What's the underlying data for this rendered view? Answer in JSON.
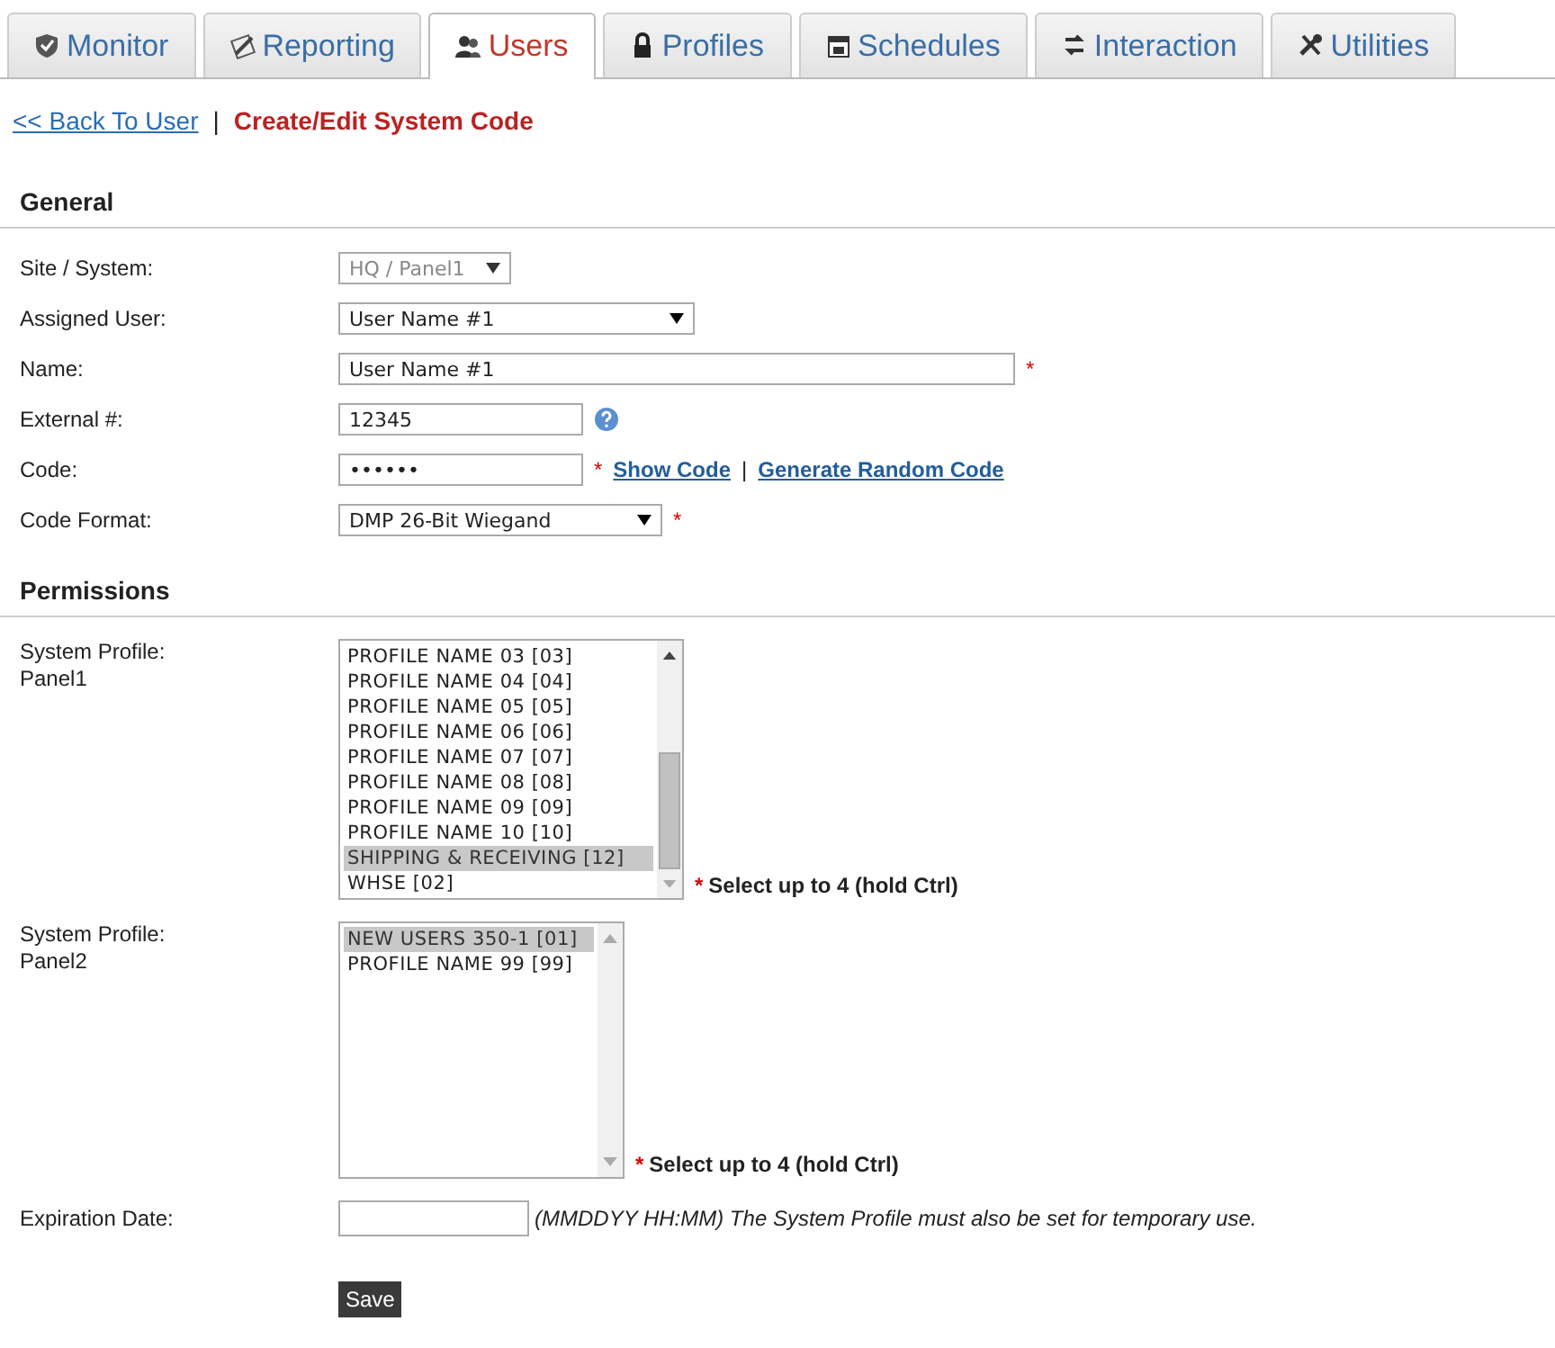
{
  "tabs": [
    {
      "label": "Monitor",
      "selected": false
    },
    {
      "label": "Reporting",
      "selected": false
    },
    {
      "label": "Users",
      "selected": true
    },
    {
      "label": "Profiles",
      "selected": false
    },
    {
      "label": "Schedules",
      "selected": false
    },
    {
      "label": "Interaction",
      "selected": false
    },
    {
      "label": "Utilities",
      "selected": false
    }
  ],
  "breadcrumb": {
    "back_link": "<< Back To User",
    "separator": "|",
    "title": "Create/Edit System Code"
  },
  "general": {
    "heading": "General",
    "fields": [
      {
        "kind": "select",
        "label": "Site / System:",
        "value": "HQ / Panel1",
        "disabled": true
      },
      {
        "kind": "select",
        "label": "Assigned User:",
        "value": "User Name #1",
        "disabled": false
      },
      {
        "kind": "text",
        "label": "Name:",
        "value": "User Name #1",
        "required_mark": "*"
      },
      {
        "kind": "text",
        "label": "External #:",
        "value": "12345",
        "help": true
      },
      {
        "kind": "password",
        "label": "Code:",
        "value": "••••••",
        "required_mark": "*",
        "links": [
          "Show Code",
          "Generate Random Code"
        ],
        "link_separator": "|"
      },
      {
        "kind": "select",
        "label": "Code Format:",
        "value": "DMP 26-Bit Wiegand",
        "disabled": false,
        "required_mark": "*"
      }
    ]
  },
  "permissions": {
    "heading": "Permissions",
    "profiles": [
      {
        "label": [
          "System Profile:",
          "Panel1"
        ],
        "items": [
          {
            "text": "PROFILE NAME 03 [03]",
            "selected": false
          },
          {
            "text": "PROFILE NAME 04 [04]",
            "selected": false
          },
          {
            "text": "PROFILE NAME 05 [05]",
            "selected": false
          },
          {
            "text": "PROFILE NAME 06 [06]",
            "selected": false
          },
          {
            "text": "PROFILE NAME 07 [07]",
            "selected": false
          },
          {
            "text": "PROFILE NAME 08 [08]",
            "selected": false
          },
          {
            "text": "PROFILE NAME 09 [09]",
            "selected": false
          },
          {
            "text": "PROFILE NAME 10 [10]",
            "selected": false
          },
          {
            "text": "SHIPPING & RECEIVING [12]",
            "selected": true
          },
          {
            "text": "WHSE [02]",
            "selected": false
          }
        ],
        "scrollable": true,
        "required_mark": "*",
        "hint": "Select up to 4 (hold Ctrl)"
      },
      {
        "label": [
          "System Profile:",
          "Panel2"
        ],
        "items": [
          {
            "text": "NEW USERS 350-1 [01]",
            "selected": true
          },
          {
            "text": "PROFILE NAME 99 [99]",
            "selected": false
          }
        ],
        "scrollable": false,
        "required_mark": "*",
        "hint": "Select up to 4 (hold Ctrl)"
      }
    ],
    "expiration": {
      "label": "Expiration Date:",
      "hint": "(MMDDYY HH:MM) The System Profile must also be set for temporary use."
    }
  },
  "save_button": "Save"
}
